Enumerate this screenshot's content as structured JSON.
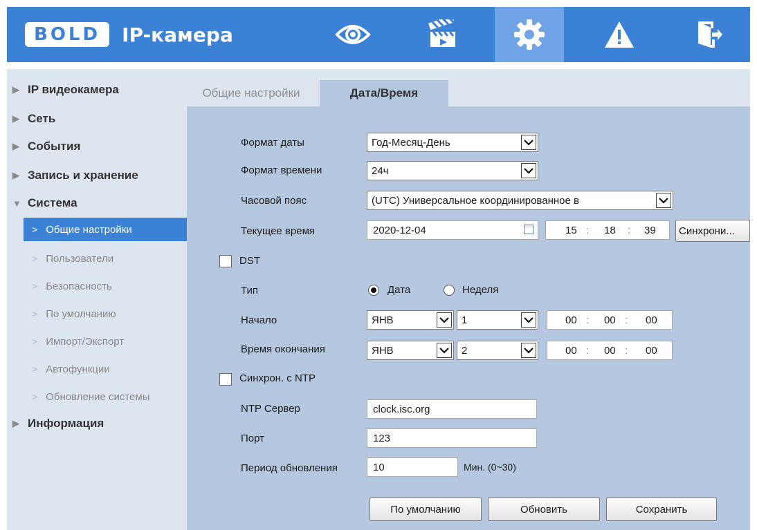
{
  "header": {
    "logo": "BOLD",
    "title": "IP-камера",
    "nav": [
      {
        "icon": "eye-icon",
        "name": "live-view"
      },
      {
        "icon": "clapperboard-icon",
        "name": "playback"
      },
      {
        "icon": "gear-icon",
        "name": "settings"
      },
      {
        "icon": "warning-icon",
        "name": "alarm"
      },
      {
        "icon": "logout-icon",
        "name": "logout"
      }
    ],
    "active_nav": "settings",
    "colors": {
      "bar": "#3b81d6",
      "active": "#6fa4e6"
    }
  },
  "sidebar": {
    "items": [
      {
        "label": "IP видеокамера"
      },
      {
        "label": "Сеть"
      },
      {
        "label": "События"
      },
      {
        "label": "Запись и хранение"
      },
      {
        "label": "Система"
      },
      {
        "label": "Информация"
      }
    ],
    "system_sub": [
      {
        "label": "Общие настройки"
      },
      {
        "label": "Пользователи"
      },
      {
        "label": "Безопасность"
      },
      {
        "label": "По умолчанию"
      },
      {
        "label": "Импорт/Экспорт"
      },
      {
        "label": "Автофункции"
      },
      {
        "label": "Обновление системы"
      }
    ]
  },
  "tabs": [
    {
      "label": "Общие настройки"
    },
    {
      "label": "Дата/Время"
    }
  ],
  "form": {
    "date_format": {
      "label": "Формат даты",
      "value": "Год-Месяц-День"
    },
    "time_format": {
      "label": "Формат времени",
      "value": "24ч"
    },
    "timezone": {
      "label": "Часовой пояс",
      "value": "(UTC) Универсальное координированное в"
    },
    "current_time": {
      "label": "Текущее время",
      "date": "2020-12-04",
      "hh": "15",
      "mm": "18",
      "ss": "39",
      "sync_button": "Синхрони..."
    },
    "dst": {
      "label": "DST",
      "checked": false
    },
    "type": {
      "label": "Тип",
      "option_date": "Дата",
      "option_week": "Неделя",
      "selected": "Дата"
    },
    "start": {
      "label": "Начало",
      "month": "ЯНВ",
      "day": "1",
      "hh": "00",
      "mm": "00",
      "ss": "00"
    },
    "end": {
      "label": "Время окончания",
      "month": "ЯНВ",
      "day": "2",
      "hh": "00",
      "mm": "00",
      "ss": "00"
    },
    "ntp_sync": {
      "label": "Синхрон. с NTP",
      "checked": false
    },
    "ntp_server": {
      "label": "NTP Сервер",
      "value": "clock.isc.org"
    },
    "port": {
      "label": "Порт",
      "value": "123"
    },
    "update_period": {
      "label": "Период обновления",
      "value": "10",
      "unit": "Мин. (0~30)"
    }
  },
  "buttons": {
    "default": "По умолчанию",
    "refresh": "Обновить",
    "save": "Сохранить"
  }
}
